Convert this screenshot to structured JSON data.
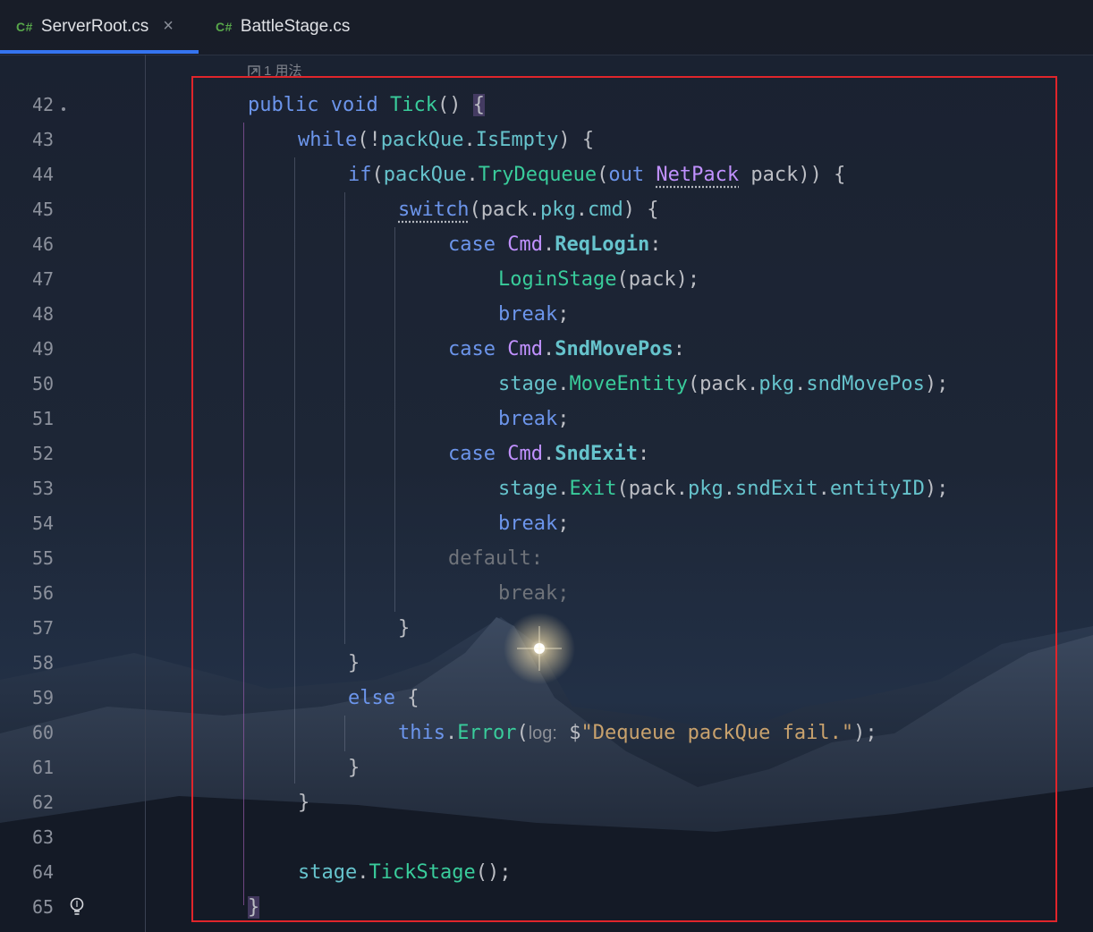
{
  "tabs": [
    {
      "lang": "C#",
      "label": "ServerRoot.cs",
      "close": "×"
    },
    {
      "lang": "C#",
      "label": "BattleStage.cs"
    }
  ],
  "colors": {
    "keyword": "#6c95eb",
    "function": "#39cc9b",
    "type": "#c191ff",
    "member": "#66c3cc",
    "string": "#c9a26d",
    "highlight_box": "#e0252b",
    "tab_accent": "#3574f0"
  },
  "editor": {
    "usage_hint": "1 用法",
    "line_numbers": [
      "42",
      "43",
      "44",
      "45",
      "46",
      "47",
      "48",
      "49",
      "50",
      "51",
      "52",
      "53",
      "54",
      "55",
      "56",
      "57",
      "58",
      "59",
      "60",
      "61",
      "62",
      "63",
      "64",
      "65"
    ],
    "lines": {
      "l42": {
        "kw1": "public",
        "kw2": "void",
        "fn": "Tick",
        "p": "()",
        "brace": "{"
      },
      "l43": {
        "kw": "while",
        "t1": "(!",
        "mem1": "packQue",
        "dot": ".",
        "mem2": "IsEmpty",
        "t2": ") {"
      },
      "l44": {
        "kw": "if",
        "t1": "(",
        "mem1": "packQue",
        "dot": ".",
        "fn": "TryDequeue",
        "t2": "(",
        "kw2": "out",
        "ty": "NetPack",
        "t3": " pack)) {"
      },
      "l45": {
        "kw": "switch",
        "t1": "(pack.",
        "mem1": "pkg",
        "dot": ".",
        "mem2": "cmd",
        "t2": ") {"
      },
      "l46": {
        "kw": "case",
        "ty": "Cmd",
        "dot": ".",
        "val": "ReqLogin",
        "colon": ":"
      },
      "l47": {
        "fn": "LoginStage",
        "t": "(pack);"
      },
      "l48": {
        "kw": "break",
        "semi": ";"
      },
      "l49": {
        "kw": "case",
        "ty": "Cmd",
        "dot": ".",
        "val": "SndMovePos",
        "colon": ":"
      },
      "l50": {
        "mem1": "stage",
        "dot1": ".",
        "fn": "MoveEntity",
        "t1": "(pack.",
        "mem2": "pkg",
        "dot2": ".",
        "mem3": "sndMovePos",
        "t2": ");"
      },
      "l51": {
        "kw": "break",
        "semi": ";"
      },
      "l52": {
        "kw": "case",
        "ty": "Cmd",
        "dot": ".",
        "val": "SndExit",
        "colon": ":"
      },
      "l53": {
        "mem1": "stage",
        "dot1": ".",
        "fn": "Exit",
        "t1": "(pack.",
        "mem2": "pkg",
        "dot2": ".",
        "mem3": "sndExit",
        "dot3": ".",
        "mem4": "entityID",
        "t2": ");"
      },
      "l54": {
        "kw": "break",
        "semi": ";"
      },
      "l55": {
        "t": "default:"
      },
      "l56": {
        "t": "break;"
      },
      "l57": {
        "t": "}"
      },
      "l58": {
        "t": "}"
      },
      "l59": {
        "kw": "else",
        "t": " {"
      },
      "l60": {
        "kw": "this",
        "dot": ".",
        "fn": "Error",
        "t1": "(",
        "param": "log:",
        "str_pre": " $",
        "str": "\"Dequeue packQue fail.\"",
        "t2": ");"
      },
      "l61": {
        "t": "}"
      },
      "l62": {
        "t": "}"
      },
      "l64": {
        "mem": "stage",
        "dot": ".",
        "fn": "TickStage",
        "t": "();"
      },
      "l65": {
        "brace": "}"
      }
    }
  }
}
